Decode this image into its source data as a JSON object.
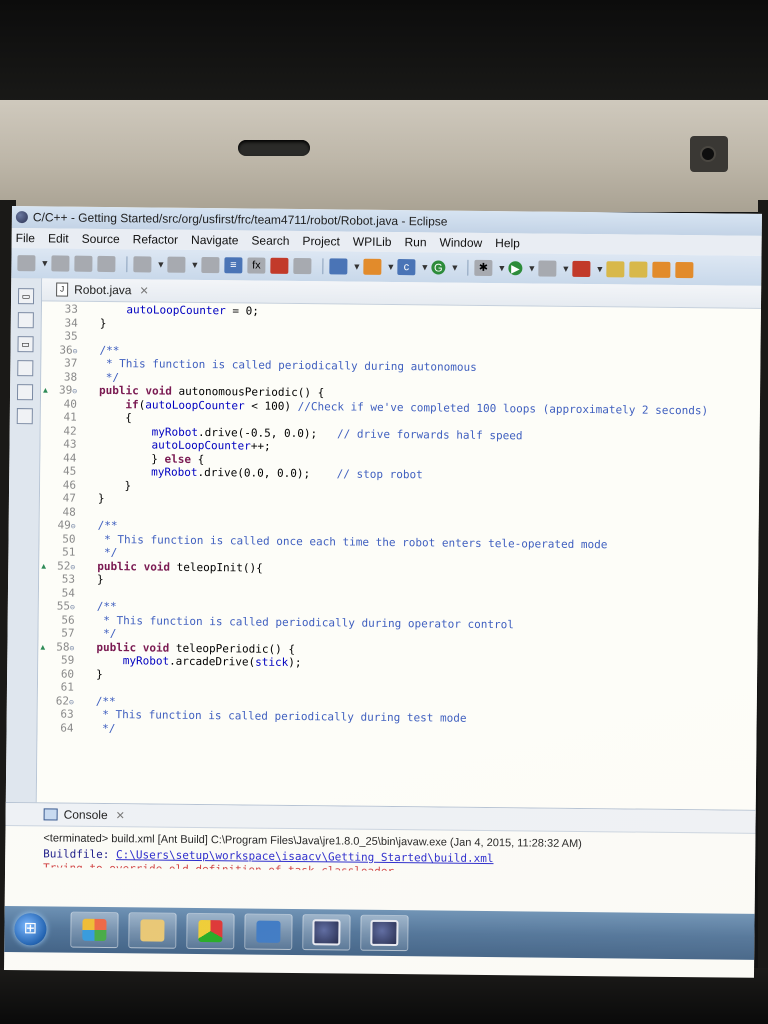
{
  "window": {
    "title": "C/C++ - Getting Started/src/org/usfirst/frc/team4711/robot/Robot.java - Eclipse"
  },
  "menubar": {
    "items": [
      "File",
      "Edit",
      "Source",
      "Refactor",
      "Navigate",
      "Search",
      "Project",
      "WPILib",
      "Run",
      "Window",
      "Help"
    ]
  },
  "editor": {
    "tab_label": "Robot.java",
    "lines": [
      {
        "n": "33",
        "text": "    autoLoopCounter = 0;"
      },
      {
        "n": "34",
        "text": "}"
      },
      {
        "n": "35",
        "text": ""
      },
      {
        "n": "36",
        "text": "/**",
        "fold": true
      },
      {
        "n": "37",
        "text": " * This function is called periodically during autonomous"
      },
      {
        "n": "38",
        "text": " */"
      },
      {
        "n": "39",
        "text": "public void autonomousPeriodic() {",
        "fold": true,
        "override": true
      },
      {
        "n": "40",
        "text": "    if(autoLoopCounter < 100) //Check if we've completed 100 loops (approximately 2 seconds)"
      },
      {
        "n": "41",
        "text": "    {"
      },
      {
        "n": "42",
        "text": "        myRobot.drive(-0.5, 0.0);   // drive forwards half speed"
      },
      {
        "n": "43",
        "text": "        autoLoopCounter++;"
      },
      {
        "n": "44",
        "text": "        } else {"
      },
      {
        "n": "45",
        "text": "        myRobot.drive(0.0, 0.0);    // stop robot"
      },
      {
        "n": "46",
        "text": "    }"
      },
      {
        "n": "47",
        "text": "}"
      },
      {
        "n": "48",
        "text": ""
      },
      {
        "n": "49",
        "text": "/**",
        "fold": true
      },
      {
        "n": "50",
        "text": " * This function is called once each time the robot enters tele-operated mode"
      },
      {
        "n": "51",
        "text": " */"
      },
      {
        "n": "52",
        "text": "public void teleopInit(){",
        "fold": true,
        "override": true
      },
      {
        "n": "53",
        "text": "}"
      },
      {
        "n": "54",
        "text": ""
      },
      {
        "n": "55",
        "text": "/**",
        "fold": true
      },
      {
        "n": "56",
        "text": " * This function is called periodically during operator control"
      },
      {
        "n": "57",
        "text": " */"
      },
      {
        "n": "58",
        "text": "public void teleopPeriodic() {",
        "fold": true,
        "override": true
      },
      {
        "n": "59",
        "text": "    myRobot.arcadeDrive(stick);"
      },
      {
        "n": "60",
        "text": "}"
      },
      {
        "n": "61",
        "text": ""
      },
      {
        "n": "62",
        "text": "/**",
        "fold": true
      },
      {
        "n": "63",
        "text": " * This function is called periodically during test mode"
      },
      {
        "n": "64",
        "text": " */"
      }
    ]
  },
  "console": {
    "tab_label": "Console",
    "terminated_line": "<terminated> build.xml [Ant Build] C:\\Program Files\\Java\\jre1.8.0_25\\bin\\javaw.exe (Jan 4, 2015, 11:28:32 AM)",
    "buildfile_label": "Buildfile:",
    "buildfile_path": "C:\\Users\\setup\\workspace\\isaacv\\Getting Started\\build.xml",
    "partial_line": "Trying to override old definition of task classloader"
  },
  "taskbar": {
    "items": [
      "start-button",
      "metro-app",
      "file-explorer",
      "chrome",
      "teamviewer",
      "eclipse",
      "eclipse"
    ]
  },
  "colors": {
    "keyword": "#7a1a52",
    "comment": "#3f5fbf",
    "field": "#0000c0",
    "taskbar": "#4d7197"
  }
}
